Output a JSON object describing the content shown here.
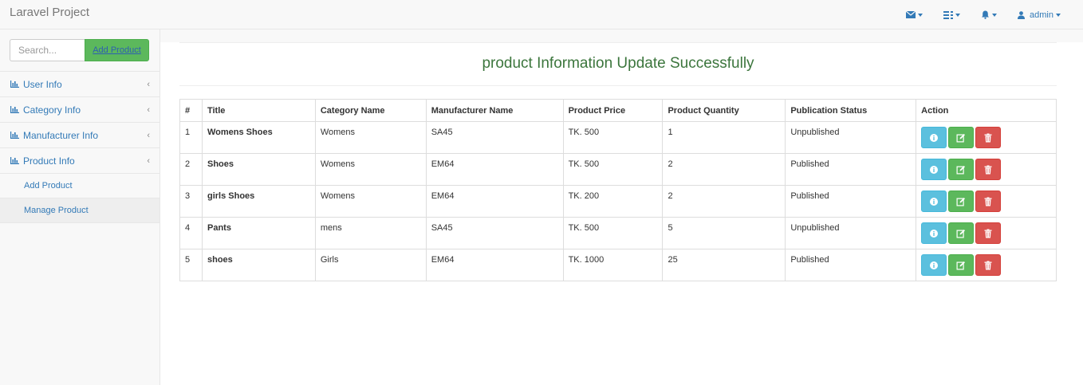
{
  "navbar": {
    "brand": "Laravel Project",
    "items": [
      {
        "icon": "envelope-icon"
      },
      {
        "icon": "tasks-icon"
      },
      {
        "icon": "bell-icon"
      },
      {
        "icon": "user-icon",
        "label": "admin"
      }
    ]
  },
  "sidebar": {
    "search": {
      "placeholder": "Search...",
      "value": ""
    },
    "add_button_label": "Add Product",
    "menu": [
      {
        "label": "User Info",
        "icon": "bar-chart-icon"
      },
      {
        "label": "Category Info",
        "icon": "bar-chart-icon"
      },
      {
        "label": "Manufacturer Info",
        "icon": "bar-chart-icon"
      },
      {
        "label": "Product Info",
        "icon": "bar-chart-icon"
      }
    ],
    "submenu": [
      {
        "label": "Add Product",
        "active": false
      },
      {
        "label": "Manage Product",
        "active": true
      }
    ]
  },
  "main": {
    "message": "product Information Update Successfully",
    "table": {
      "headers": [
        "#",
        "Title",
        "Category Name",
        "Manufacturer Name",
        "Product Price",
        "Product Quantity",
        "Publication Status",
        "Action"
      ],
      "rows": [
        [
          "1",
          "Womens Shoes",
          "Womens",
          "SA45",
          "TK. 500",
          "1",
          "Unpublished"
        ],
        [
          "2",
          "Shoes",
          "Womens",
          "EM64",
          "TK. 500",
          "2",
          "Published"
        ],
        [
          "3",
          "girls Shoes",
          "Womens",
          "EM64",
          "TK. 200",
          "2",
          "Published"
        ],
        [
          "4",
          "Pants",
          "mens",
          "SA45",
          "TK. 500",
          "5",
          "Unpublished"
        ],
        [
          "5",
          "shoes",
          "Girls",
          "EM64",
          "TK. 1000",
          "25",
          "Published"
        ]
      ]
    }
  },
  "colors": {
    "link": "#337ab7",
    "success_text": "#3c763d",
    "btn_info": "#5bc0de",
    "btn_success": "#5cb85c",
    "btn_danger": "#d9534f"
  }
}
